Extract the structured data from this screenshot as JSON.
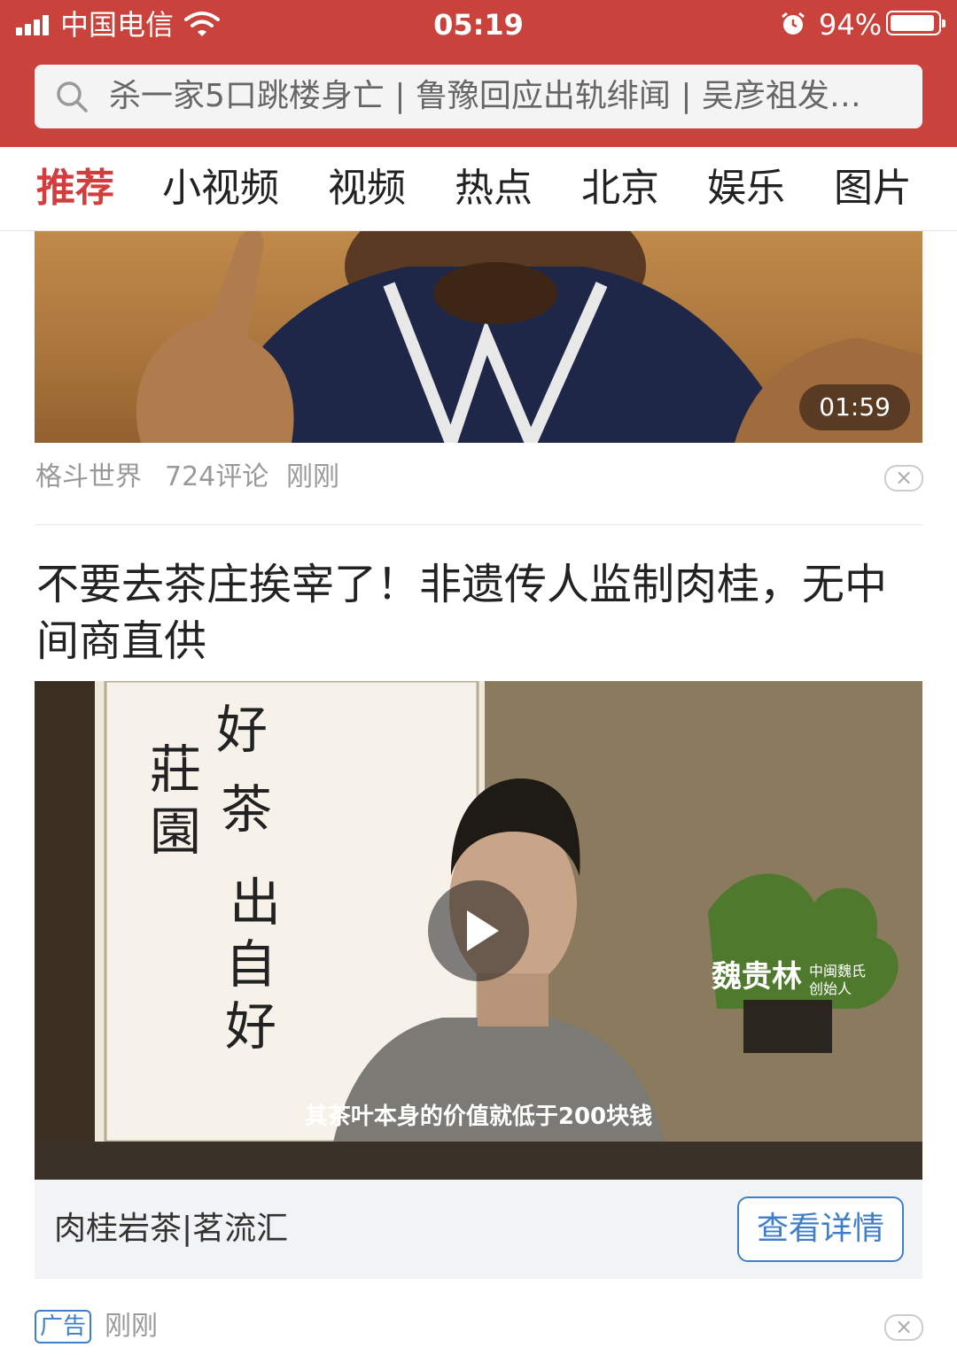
{
  "status_bar": {
    "carrier": "中国电信",
    "time": "05:19",
    "battery_percent": "94%",
    "battery_level": 0.94
  },
  "search": {
    "placeholder": "杀一家5口跳楼身亡 | 鲁豫回应出轨绯闻 | 吴彦祖发…"
  },
  "tabs": [
    {
      "label": "推荐",
      "active": true
    },
    {
      "label": "小视频"
    },
    {
      "label": "视频"
    },
    {
      "label": "热点"
    },
    {
      "label": "北京"
    },
    {
      "label": "娱乐"
    },
    {
      "label": "图片"
    }
  ],
  "feed": {
    "item1": {
      "duration": "01:59",
      "source": "格斗世界",
      "comments": "724评论",
      "time": "刚刚"
    },
    "item2": {
      "title": "不要去茶庄挨宰了！非遗传人监制肉桂，无中间商直供",
      "calligraphy": "好茶出自好庄园",
      "person_name": "魏贵林",
      "person_role": "中闽魏氏 创始人",
      "subtitle": "其茶叶本身的价值就低于200块钱",
      "advertiser": "肉桂岩茶|茗流汇",
      "cta": "查看详情",
      "ad_tag": "广告",
      "time": "刚刚"
    }
  },
  "colors": {
    "brand_red": "#c9423c",
    "tab_active": "#d43d3d",
    "link_blue": "#3f7fc9"
  }
}
